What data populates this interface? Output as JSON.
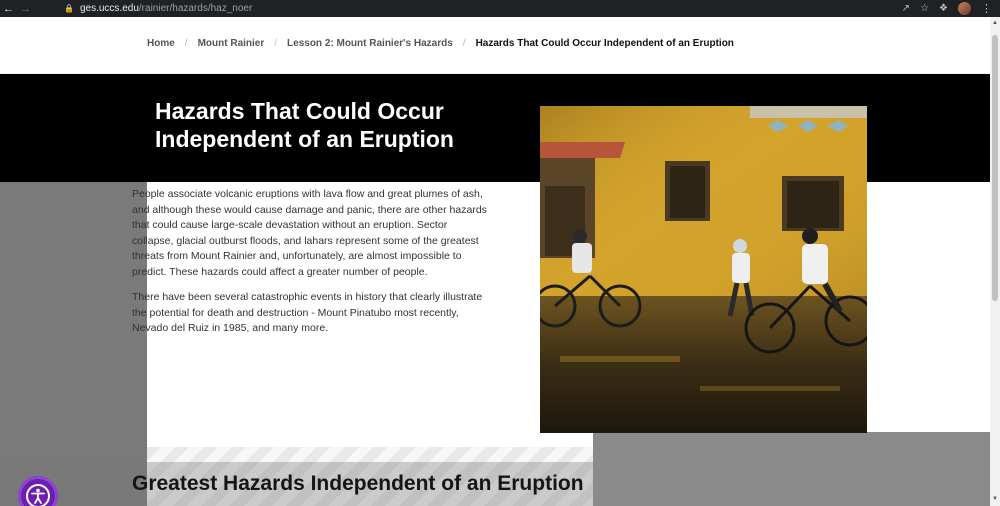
{
  "browser": {
    "url_host": "ges.uccs.edu",
    "url_path": "/rainier/hazards/haz_noer"
  },
  "breadcrumb": {
    "items": [
      "Home",
      "Mount Rainier",
      "Lesson 2: Mount Rainier's Hazards"
    ],
    "current": "Hazards That Could Occur Independent of an Eruption",
    "separator": "/"
  },
  "hero": {
    "title": "Hazards That Could Occur Independent of an Eruption"
  },
  "content": {
    "paragraphs": [
      "People associate volcanic eruptions with lava flow and great plumes of ash, and although these would cause damage and panic, there are other hazards that could cause large-scale devastation without an eruption. Sector collapse, glacial outburst floods, and lahars represent some of the greatest threats from Mount Rainier and, unfortunately, are almost impossible to predict. These hazards could affect a greater number of people.",
      "There have been several catastrophic events in history that clearly illustrate the potential for death and destruction - Mount Pinatubo most recently, Nevado del Ruiz in 1985, and many more."
    ]
  },
  "section": {
    "title": "Greatest Hazards Independent of an Eruption"
  },
  "icons": {
    "back": "back-arrow-icon",
    "forward": "forward-arrow-icon",
    "lock": "lock-icon",
    "share": "share-icon",
    "star": "star-icon",
    "extensions": "puzzle-icon",
    "accessibility": "accessibility-icon"
  },
  "colors": {
    "accent_purple": "#6b1fb1",
    "hero_bg": "#000000",
    "photo_wall": "#d8a728"
  }
}
